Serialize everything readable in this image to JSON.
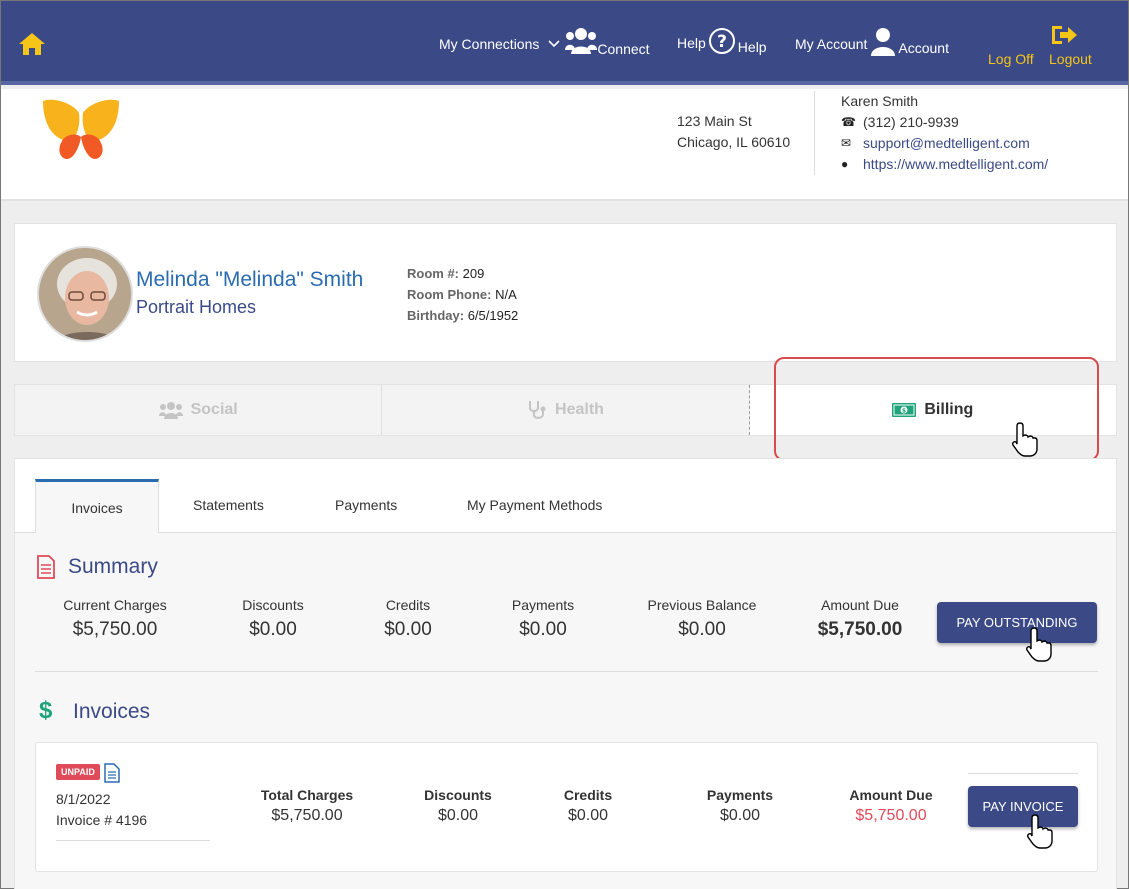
{
  "nav": {
    "connections": "My Connections",
    "connect": "Connect",
    "help_label": "Help",
    "help_sub": "Help",
    "account_label": "My Account",
    "account_sub": "Account",
    "logoff": "Log Off",
    "logout": "Logout"
  },
  "org": {
    "address1": "123 Main St",
    "address2": "Chicago, IL 60610",
    "contact_name": "Karen Smith",
    "phone": "(312) 210-9939",
    "email": "support@medtelligent.com",
    "website": "https://www.medtelligent.com/"
  },
  "resident": {
    "name": "Melinda \"Melinda\" Smith",
    "facility": "Portrait Homes",
    "room_label": "Room #:",
    "room": "209",
    "phone_label": "Room Phone:",
    "phone": "N/A",
    "birthday_label": "Birthday:",
    "birthday": "6/5/1952"
  },
  "section_tabs": [
    "Social",
    "Health",
    "Billing"
  ],
  "subtabs": [
    "Invoices",
    "Statements",
    "Payments",
    "My Payment Methods"
  ],
  "summary": {
    "title": "Summary",
    "columns": [
      {
        "label": "Current Charges",
        "value": "$5,750.00"
      },
      {
        "label": "Discounts",
        "value": "$0.00"
      },
      {
        "label": "Credits",
        "value": "$0.00"
      },
      {
        "label": "Payments",
        "value": "$0.00"
      },
      {
        "label": "Previous Balance",
        "value": "$0.00"
      },
      {
        "label": "Amount Due",
        "value": "$5,750.00"
      }
    ],
    "pay_button": "PAY OUTSTANDING"
  },
  "invoices": {
    "title": "Invoices",
    "items": [
      {
        "status": "UNPAID",
        "date": "8/1/2022",
        "number": "Invoice # 4196",
        "columns": [
          {
            "label": "Total Charges",
            "value": "$5,750.00"
          },
          {
            "label": "Discounts",
            "value": "$0.00"
          },
          {
            "label": "Credits",
            "value": "$0.00"
          },
          {
            "label": "Payments",
            "value": "$0.00"
          },
          {
            "label": "Amount Due",
            "value": "$5,750.00"
          }
        ],
        "pay_button": "PAY INVOICE"
      }
    ]
  },
  "colors": {
    "nav_bg": "#3b4a87",
    "accent_yellow": "#f5c518",
    "link_blue": "#2b6cb0",
    "due_red": "#e04b5a",
    "highlight_red": "#d94b4b",
    "billing_green": "#1fa37a"
  }
}
